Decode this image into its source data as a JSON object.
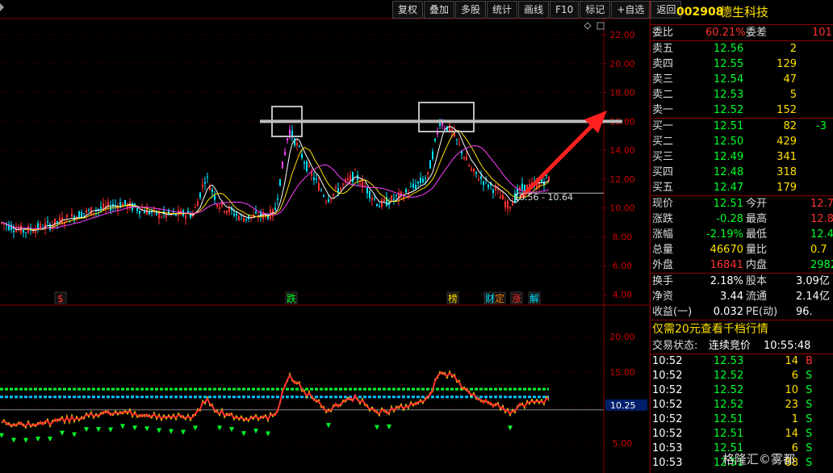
{
  "toolbar": [
    "复权",
    "叠加",
    "多股",
    "统计",
    "画线",
    "F10",
    "标记",
    "+自选",
    "返回"
  ],
  "main_chart": {
    "y_ticks": [
      "22.00",
      "20.00",
      "18.00",
      "16.00",
      "14.00",
      "12.00",
      "10.00",
      "8.00",
      "6.00",
      "4.00"
    ],
    "y_values": [
      22,
      20,
      18,
      16,
      14,
      12,
      10,
      8,
      6,
      4
    ],
    "current_price_line": 10.64,
    "range_label": "10.56 - 10.64",
    "resistance_level": 16.0,
    "event_tags": [
      {
        "text": "$",
        "color": "#ff3030",
        "x": 75
      },
      {
        "text": "跌",
        "color": "#00ff2a",
        "x": 361
      },
      {
        "text": "榜",
        "color": "#ffe000",
        "x": 561
      },
      {
        "text": "财",
        "color": "#00e5ff",
        "x": 607
      },
      {
        "text": "定",
        "color": "#ff8000",
        "x": 619
      },
      {
        "text": "涨",
        "color": "#ff3030",
        "x": 640
      },
      {
        "text": "解",
        "color": "#00e5ff",
        "x": 662
      }
    ]
  },
  "sub_chart": {
    "y_ticks": [
      "20.00",
      "15.00",
      "10.00",
      "5.00"
    ],
    "y_values": [
      20,
      15,
      10,
      5
    ],
    "current_value_label": "10.25",
    "green_line": 12.6,
    "blue_line": 11.5
  },
  "panel": {
    "stock_code": "002908",
    "stock_name": "德生科技",
    "weibi_label": "委比",
    "weibi_value": "60.21%",
    "weicha_label": "委差",
    "weicha_value": "101",
    "asks": [
      {
        "label": "卖五",
        "price": "12.56",
        "vol": "2"
      },
      {
        "label": "卖四",
        "price": "12.55",
        "vol": "129"
      },
      {
        "label": "卖三",
        "price": "12.54",
        "vol": "47"
      },
      {
        "label": "卖二",
        "price": "12.53",
        "vol": "5"
      },
      {
        "label": "卖一",
        "price": "12.52",
        "vol": "152"
      }
    ],
    "bids": [
      {
        "label": "买一",
        "price": "12.51",
        "vol": "82",
        "chg": "-3"
      },
      {
        "label": "买二",
        "price": "12.50",
        "vol": "429",
        "chg": ""
      },
      {
        "label": "买三",
        "price": "12.49",
        "vol": "341",
        "chg": ""
      },
      {
        "label": "买四",
        "price": "12.48",
        "vol": "318",
        "chg": ""
      },
      {
        "label": "买五",
        "price": "12.47",
        "vol": "179",
        "chg": ""
      }
    ],
    "stats": [
      {
        "l1": "现价",
        "v1": "12.51",
        "c1": "g",
        "l2": "今开",
        "v2": "12.7",
        "c2": "r"
      },
      {
        "l1": "涨跌",
        "v1": "-0.28",
        "c1": "g",
        "l2": "最高",
        "v2": "12.8",
        "c2": "r"
      },
      {
        "l1": "涨幅",
        "v1": "-2.19%",
        "c1": "g",
        "l2": "最低",
        "v2": "12.4",
        "c2": "g"
      },
      {
        "l1": "总量",
        "v1": "46670",
        "c1": "y",
        "l2": "量比",
        "v2": "0.7",
        "c2": "y"
      },
      {
        "l1": "外盘",
        "v1": "16841",
        "c1": "r",
        "l2": "内盘",
        "v2": "2982",
        "c2": "g"
      }
    ],
    "fundamentals": [
      {
        "l1": "换手",
        "v1": "2.18%",
        "l2": "股本",
        "v2": "3.09亿"
      },
      {
        "l1": "净资",
        "v1": "3.44",
        "l2": "流通",
        "v2": "2.14亿"
      },
      {
        "l1": "收益(一)",
        "v1": "0.032",
        "l2": "PE(动)",
        "v2": "96."
      }
    ],
    "promo": "仅需20元查看千档行情",
    "trade_state_label": "交易状态:",
    "trade_state": "连续竞价",
    "trade_time": "10:55:48",
    "ticks": [
      {
        "time": "10:52",
        "price": "12.53",
        "vol": "14",
        "side": "B"
      },
      {
        "time": "10:52",
        "price": "12.52",
        "vol": "6",
        "side": "S"
      },
      {
        "time": "10:52",
        "price": "12.52",
        "vol": "10",
        "side": "S"
      },
      {
        "time": "10:52",
        "price": "12.52",
        "vol": "23",
        "side": "S"
      },
      {
        "time": "10:52",
        "price": "12.51",
        "vol": "1",
        "side": "S"
      },
      {
        "time": "10:52",
        "price": "12.51",
        "vol": "14",
        "side": "S"
      },
      {
        "time": "10:53",
        "price": "12.51",
        "vol": "6",
        "side": "S"
      },
      {
        "time": "10:53",
        "price": "12.51",
        "vol": "88",
        "side": "S"
      }
    ],
    "watermark": "格隆汇©雾都"
  }
}
